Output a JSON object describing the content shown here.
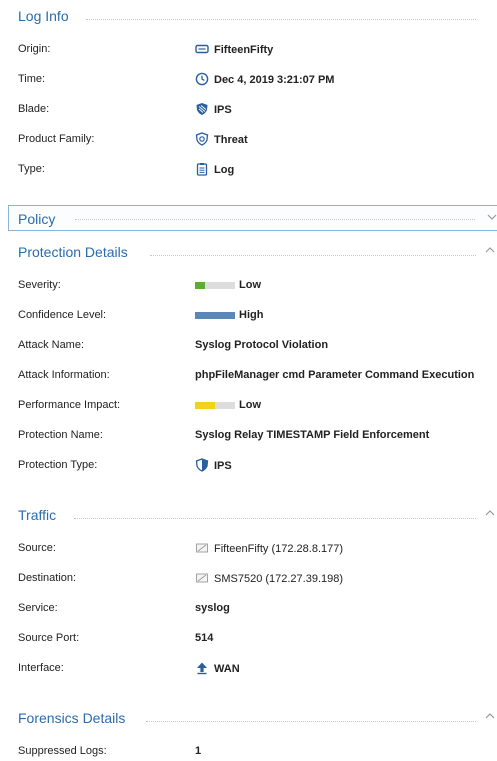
{
  "log_info": {
    "title": "Log Info",
    "origin": {
      "label": "Origin:",
      "value": "FifteenFifty",
      "icon": "gateway-icon"
    },
    "time": {
      "label": "Time:",
      "value": "Dec 4, 2019 3:21:07 PM",
      "icon": "clock-icon"
    },
    "blade": {
      "label": "Blade:",
      "value": "IPS",
      "icon": "ips-shield-icon"
    },
    "product_family": {
      "label": "Product Family:",
      "value": "Threat",
      "icon": "threat-shield-icon"
    },
    "type": {
      "label": "Type:",
      "value": "Log",
      "icon": "log-clipboard-icon"
    }
  },
  "policy": {
    "title": "Policy",
    "collapsed": true
  },
  "protection_details": {
    "title": "Protection Details",
    "severity": {
      "label": "Severity:",
      "value": "Low",
      "level_fraction": 0.25,
      "color": "#5cae2e"
    },
    "confidence": {
      "label": "Confidence Level:",
      "value": "High",
      "level_fraction": 1.0,
      "color": "#5b87b8"
    },
    "attack_name": {
      "label": "Attack Name:",
      "value": "Syslog Protocol Violation"
    },
    "attack_information": {
      "label": "Attack Information:",
      "value": "phpFileManager cmd Parameter Command Execution"
    },
    "performance_impact": {
      "label": "Performance Impact:",
      "value": "Low",
      "level_fraction": 0.5,
      "color": "#f2d21b"
    },
    "protection_name": {
      "label": "Protection Name:",
      "value": "Syslog Relay TIMESTAMP Field Enforcement"
    },
    "protection_type": {
      "label": "Protection Type:",
      "value": "IPS",
      "icon": "ips-shield-icon"
    }
  },
  "traffic": {
    "title": "Traffic",
    "source": {
      "label": "Source:",
      "value": "FifteenFifty (172.28.8.177)",
      "icon": "host-icon"
    },
    "destination": {
      "label": "Destination:",
      "value": "SMS7520 (172.27.39.198)",
      "icon": "host-icon"
    },
    "service": {
      "label": "Service:",
      "value": "syslog"
    },
    "source_port": {
      "label": "Source Port:",
      "value": "514"
    },
    "interface": {
      "label": "Interface:",
      "value": "WAN",
      "icon": "upload-arrow-icon"
    }
  },
  "forensics_details": {
    "title": "Forensics Details",
    "suppressed_logs": {
      "label": "Suppressed Logs:",
      "value": "1"
    }
  },
  "colors": {
    "accent": "#2a6cad",
    "bar_empty": "#dddddd"
  }
}
